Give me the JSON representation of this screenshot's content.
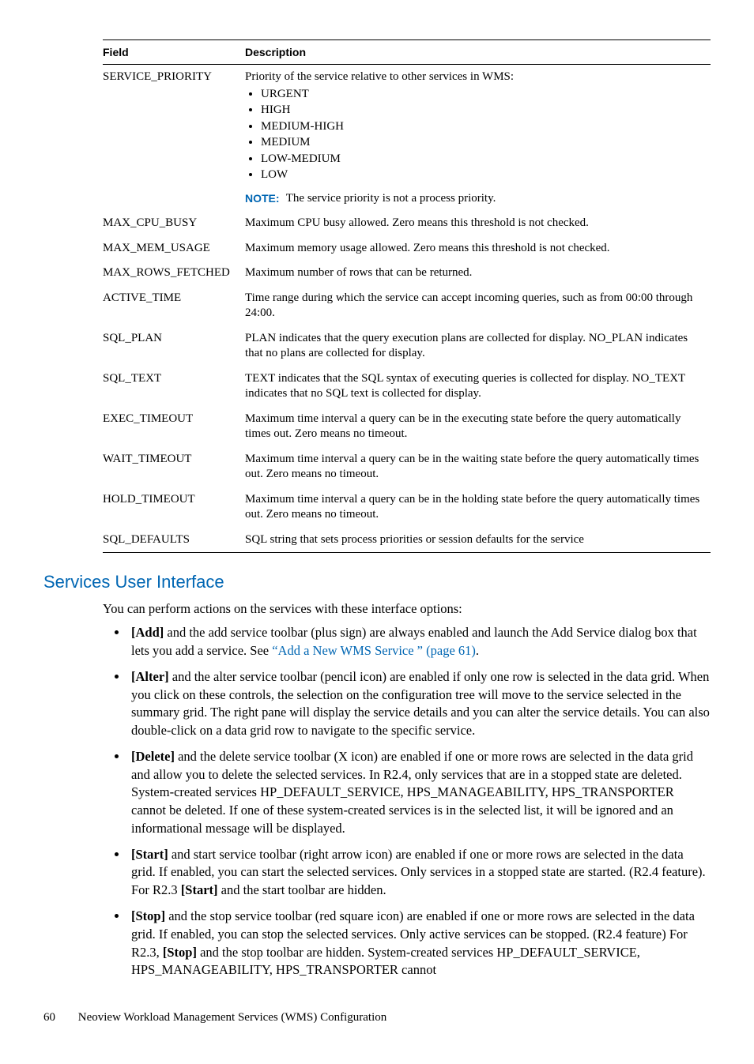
{
  "table": {
    "headers": {
      "field": "Field",
      "description": "Description"
    },
    "rows": [
      {
        "field": "SERVICE_PRIORITY",
        "intro": "Priority of the service relative to other services in WMS:",
        "priorities": [
          "URGENT",
          "HIGH",
          "MEDIUM-HIGH",
          "MEDIUM",
          "LOW-MEDIUM",
          "LOW"
        ],
        "note_label": "NOTE:",
        "note_text": "The service priority is not a process priority."
      },
      {
        "field": "MAX_CPU_BUSY",
        "desc": "Maximum CPU busy allowed. Zero means this threshold is not checked."
      },
      {
        "field": "MAX_MEM_USAGE",
        "desc": "Maximum memory usage allowed. Zero means this threshold is not checked."
      },
      {
        "field": "MAX_ROWS_FETCHED",
        "desc": "Maximum number of rows that can be returned."
      },
      {
        "field": "ACTIVE_TIME",
        "desc": "Time range during which the service can accept incoming queries, such as from 00:00 through 24:00."
      },
      {
        "field": "SQL_PLAN",
        "desc": "PLAN indicates that the query execution plans are collected for display. NO_PLAN indicates that no plans are collected for display."
      },
      {
        "field": "SQL_TEXT",
        "desc": "TEXT indicates that the SQL syntax of executing queries is collected for display. NO_TEXT indicates that no SQL text is collected for display."
      },
      {
        "field": "EXEC_TIMEOUT",
        "desc": "Maximum time interval a query can be in the executing state before the query automatically times out. Zero means no timeout."
      },
      {
        "field": "WAIT_TIMEOUT",
        "desc": "Maximum time interval a query can be in the waiting state before the query automatically times out. Zero means no timeout."
      },
      {
        "field": "HOLD_TIMEOUT",
        "desc": "Maximum time interval a query can be in the holding state before the query automatically times out. Zero means no timeout."
      },
      {
        "field": "SQL_DEFAULTS",
        "desc": "SQL string that sets process priorities or session defaults for the service"
      }
    ]
  },
  "section_title": "Services User Interface",
  "section_intro": "You can perform actions on the services with these interface options:",
  "actions": {
    "add": {
      "label": "[Add]",
      "text_before": " and the add service toolbar (plus sign) are always enabled and launch the Add Service dialog box that lets you add a service. See ",
      "link": "“Add a New WMS Service ” (page 61)",
      "text_after": "."
    },
    "alter": {
      "label": "[Alter]",
      "text": " and the alter service toolbar (pencil icon) are enabled if only one row is selected in the data grid. When you click on these controls, the selection on the configuration tree will move to the service selected in the summary grid. The right pane will display the service details and you can alter the service details. You can also double-click on a data grid row to navigate to the specific service."
    },
    "delete": {
      "label": "[Delete]",
      "text": " and the delete service toolbar (X icon) are enabled if one or more rows are selected in the data grid and allow you to delete the selected services. In R2.4, only services that are in a stopped state are deleted. System-created services HP_DEFAULT_SERVICE, HPS_MANAGEABILITY, HPS_TRANSPORTER cannot be deleted. If one of these system-created services is in the selected list, it will be ignored and an informational message will be displayed."
    },
    "start": {
      "label": "[Start]",
      "text_a": " and start service toolbar (right arrow icon) are enabled if one or more rows are selected in the data grid. If enabled, you can start the selected services. Only services in a stopped state are started. (R2.4 feature). For R2.3 ",
      "label2": "[Start]",
      "text_b": " and the start toolbar are hidden."
    },
    "stop": {
      "label": "[Stop]",
      "text_a": " and the stop service toolbar (red square icon) are enabled if one or more rows are selected in the data grid. If enabled, you can stop the selected services. Only active services can be stopped. (R2.4 feature) For R2.3, ",
      "label2": "[Stop]",
      "text_b": " and the stop toolbar are hidden. System-created services HP_DEFAULT_SERVICE, HPS_MANAGEABILITY, HPS_TRANSPORTER cannot"
    }
  },
  "footer": {
    "page": "60",
    "title": "Neoview Workload Management Services (WMS) Configuration"
  }
}
